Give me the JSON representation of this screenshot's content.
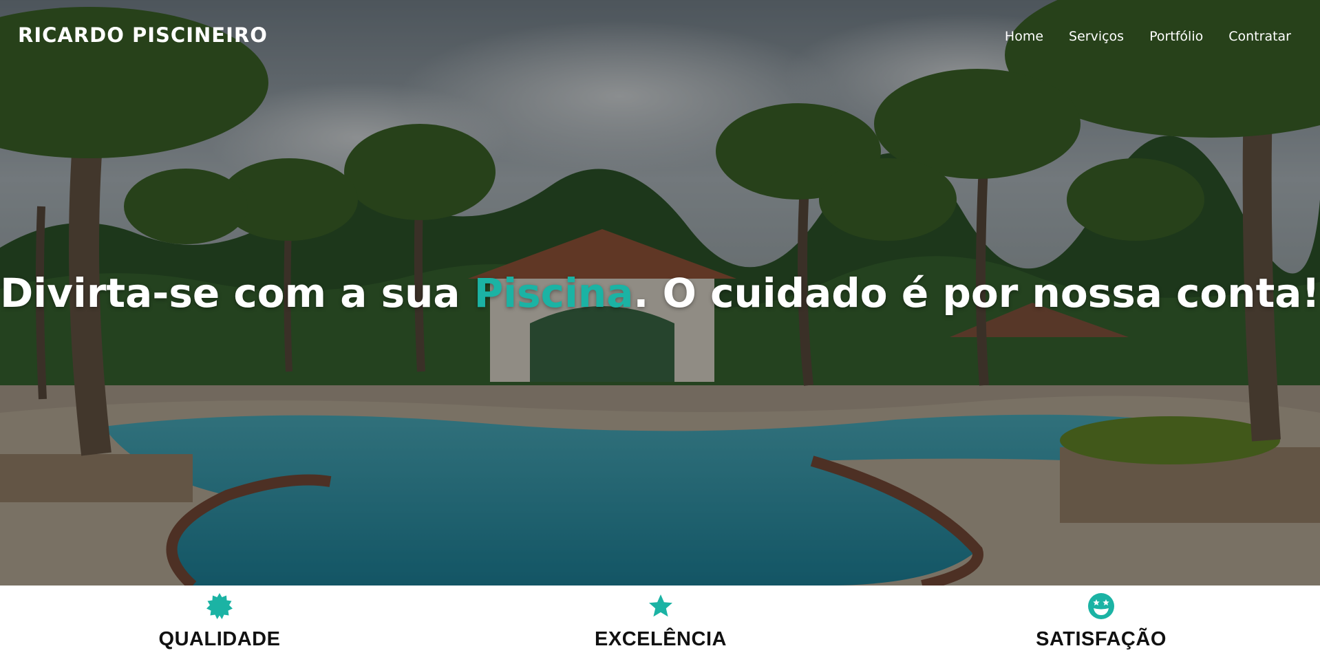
{
  "brand": {
    "name": "RICARDO PISCINEIRO"
  },
  "nav": {
    "items": [
      {
        "label": "Home"
      },
      {
        "label": "Serviços"
      },
      {
        "label": "Portfólio"
      },
      {
        "label": "Contratar"
      }
    ]
  },
  "hero": {
    "headline_before": "Divirta-se com a sua ",
    "headline_accent": "Piscina",
    "headline_after": ". O cuidado é por nossa conta!",
    "background_image": "resort-pool-with-palm-trees"
  },
  "features": [
    {
      "label": "QUALIDADE",
      "icon": "certificate-badge-icon"
    },
    {
      "label": "EXCELÊNCIA",
      "icon": "star-icon"
    },
    {
      "label": "SATISFAÇÃO",
      "icon": "grin-stars-icon"
    }
  ],
  "colors": {
    "accent": "#1bb3a4",
    "text_dark": "#111111",
    "text_light": "#ffffff"
  }
}
